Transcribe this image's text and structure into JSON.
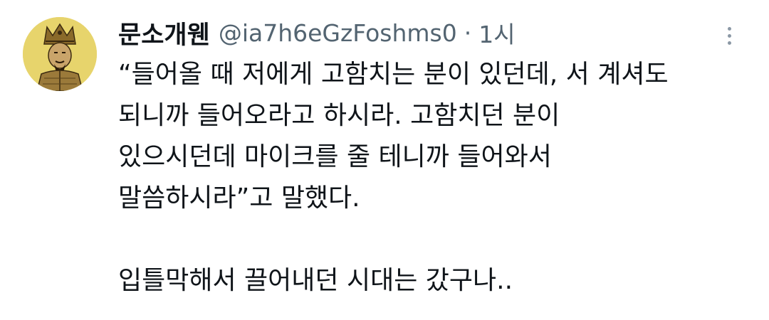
{
  "tweet": {
    "author": {
      "display_name": "문소개웬",
      "handle": "@ia7h6eGzFoshms0",
      "avatar_icon": "portrait-avatar"
    },
    "separator": "·",
    "time": "1시",
    "more_icon": "vertical-ellipsis-icon",
    "text_lines": [
      "“들어올 때 저에게 고함치는 분이 있던데, 서 계셔도",
      "되니까 들어오라고 하시라. 고함치던 분이",
      "있으시던데 마이크를 줄 테니까 들어와서",
      "말씀하시라”고 말했다."
    ],
    "text_final": "입틀막해서 끌어내던 시대는 갔구나.."
  }
}
